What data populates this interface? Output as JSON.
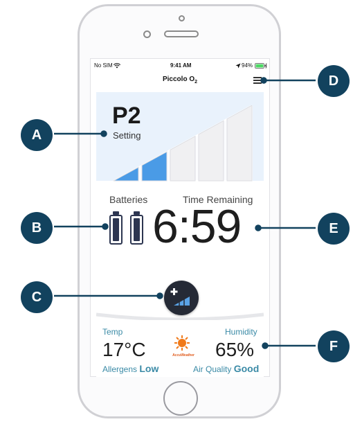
{
  "status_bar": {
    "carrier": "No SIM",
    "time": "9:41 AM",
    "battery": "94%"
  },
  "nav": {
    "title": "Piccolo O",
    "title_sub": "2"
  },
  "setting": {
    "level": "P2",
    "label": "Setting",
    "bars_total": 5,
    "bars_active": 2
  },
  "power": {
    "batteries_label": "Batteries",
    "time_label": "Time Remaining",
    "time_value": "6:59"
  },
  "weather": {
    "temp_label": "Temp",
    "temp_value": "17°C",
    "humidity_label": "Humidity",
    "humidity_value": "65%",
    "brand": "AccuWeather",
    "allergens_label": "Allergens",
    "allergens_value": "Low",
    "air_quality_label": "Air Quality",
    "air_quality_value": "Good"
  },
  "callouts": [
    "A",
    "B",
    "C",
    "D",
    "E",
    "F"
  ],
  "colors": {
    "callout": "#12425e",
    "accent": "#3a8aa6",
    "bar_active": "#4a9be6",
    "bar_inactive": "#f0f0f2",
    "setting_bg": "#e9f2fc"
  }
}
